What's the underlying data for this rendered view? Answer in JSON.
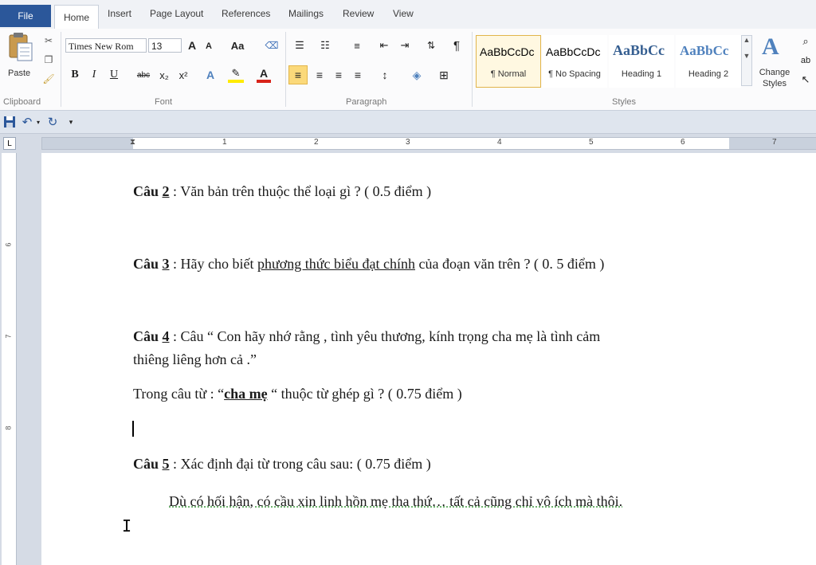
{
  "tabs": {
    "file": "File",
    "home": "Home",
    "insert": "Insert",
    "page_layout": "Page Layout",
    "references": "References",
    "mailings": "Mailings",
    "review": "Review",
    "view": "View"
  },
  "ribbon": {
    "clipboard": {
      "paste": "Paste",
      "label": "Clipboard"
    },
    "font": {
      "name": "Times New Rom",
      "size": "13",
      "label": "Font"
    },
    "paragraph": {
      "label": "Paragraph"
    },
    "styles": {
      "label": "Styles",
      "items": [
        {
          "sample": "AaBbCcDc",
          "name": "¶ Normal"
        },
        {
          "sample": "AaBbCcDc",
          "name": "¶ No Spacing"
        },
        {
          "sample": "AaBbCc",
          "name": "Heading 1"
        },
        {
          "sample": "AaBbCc",
          "name": "Heading 2"
        }
      ],
      "change_styles": "Change Styles"
    }
  },
  "ruler": {
    "numbers": [
      "1",
      "2",
      "3",
      "4",
      "5",
      "6",
      "7"
    ]
  },
  "vruler": {
    "numbers": [
      "6",
      "7",
      "8"
    ]
  },
  "document": {
    "q2": {
      "label": "Câu",
      "num": "2",
      "text": " : Văn bản trên thuộc thể loại gì ? ( 0.5 điểm )"
    },
    "q3": {
      "label": "Câu",
      "num": "3",
      "pre": " : Hãy cho biết ",
      "under": "phương thức biểu đạt chính",
      "post": " của đoạn văn trên ? ( 0. 5 điểm )"
    },
    "q4": {
      "label": "Câu",
      "num": "4",
      "line1": " : Câu  “ Con hãy nhớ rằng , tình yêu thương, kính trọng cha mẹ là tình cảm",
      "line2": "thiêng liêng hơn cả .”"
    },
    "q4b": {
      "pre": "Trong câu từ : “",
      "bold": "cha mẹ",
      "post": " “ thuộc từ ghép gì ? ( 0.75 điểm )"
    },
    "q5": {
      "label": "Câu",
      "num": "5",
      "text": " : Xác định đại từ trong câu sau: ( 0.75 điểm )"
    },
    "q5_sentence": "Dù có hối hận, có cầu xin linh hồn mẹ tha thứ… tất cả cũng chỉ vô ích mà thôi."
  }
}
